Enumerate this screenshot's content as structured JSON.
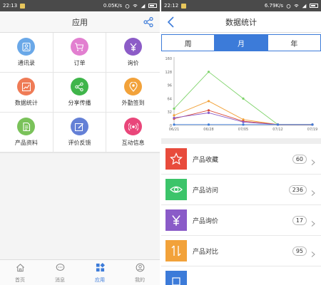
{
  "left": {
    "status": {
      "time": "22:13",
      "speed": "0.05K/s"
    },
    "navbar": {
      "title": "应用"
    },
    "grid": [
      {
        "label": "通讯录",
        "icon": "contacts-icon",
        "color": "#6aa8e8"
      },
      {
        "label": "订单",
        "icon": "cart-icon",
        "color": "#e27fd0"
      },
      {
        "label": "询价",
        "icon": "yen-icon",
        "color": "#8c5cc7"
      },
      {
        "label": "数据统计",
        "icon": "trend-chart-icon",
        "color": "#ef7b56"
      },
      {
        "label": "分享传播",
        "icon": "share-icon",
        "color": "#3fb54a"
      },
      {
        "label": "外勤签到",
        "icon": "location-pin-icon",
        "color": "#f2a23a"
      },
      {
        "label": "产品资料",
        "icon": "document-icon",
        "color": "#7ac25a"
      },
      {
        "label": "评价反馈",
        "icon": "edit-icon",
        "color": "#6480d6"
      },
      {
        "label": "互动信息",
        "icon": "broadcast-icon",
        "color": "#e9467a"
      }
    ],
    "tabbar": [
      {
        "label": "首页",
        "icon": "home-icon"
      },
      {
        "label": "消息",
        "icon": "message-icon"
      },
      {
        "label": "应用",
        "icon": "apps-icon"
      },
      {
        "label": "我的",
        "icon": "profile-icon"
      }
    ],
    "active_tab": "应用"
  },
  "right": {
    "status": {
      "time": "22:12",
      "speed": "6.79K/s"
    },
    "navbar": {
      "title": "数据统计"
    },
    "segments": [
      "周",
      "月",
      "年"
    ],
    "active_segment": "月",
    "chart_data": {
      "type": "line",
      "categories": [
        "06/21",
        "06/28",
        "07/05",
        "07/12",
        "07/19"
      ],
      "ylim": [
        0,
        160
      ],
      "yticks": [
        0,
        32,
        64,
        96,
        128,
        160
      ],
      "grid": false,
      "series": [
        {
          "color": "#7ed36a",
          "values": [
            40,
            128,
            64,
            2,
            2
          ]
        },
        {
          "color": "#f2a23a",
          "values": [
            24,
            58,
            14,
            2,
            2
          ]
        },
        {
          "color": "#d84a3a",
          "values": [
            16,
            36,
            10,
            2,
            2
          ]
        },
        {
          "color": "#8a5bc8",
          "values": [
            18,
            30,
            8,
            2,
            2
          ]
        },
        {
          "color": "#3c7bd9",
          "values": [
            2,
            2,
            2,
            2,
            2
          ]
        }
      ]
    },
    "stats": [
      {
        "label": "产品收藏",
        "count": "60",
        "icon": "star-icon",
        "color": "#e84b3c"
      },
      {
        "label": "产品访问",
        "count": "236",
        "icon": "eye-icon",
        "color": "#3cc46a"
      },
      {
        "label": "产品询价",
        "count": "17",
        "icon": "yen-icon",
        "color": "#8a5bc8"
      },
      {
        "label": "产品对比",
        "count": "95",
        "icon": "compare-icon",
        "color": "#f2a23a"
      },
      {
        "label": "",
        "count": "",
        "icon": "generic-icon",
        "color": "#3c7bd9"
      }
    ]
  }
}
